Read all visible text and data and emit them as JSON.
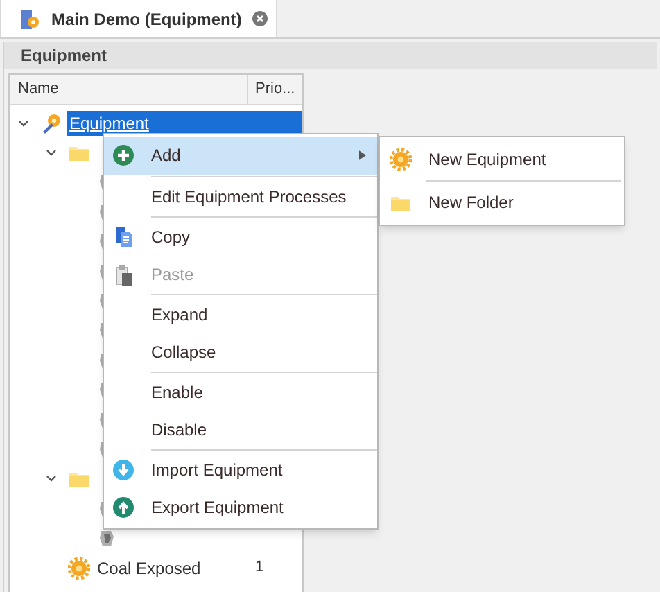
{
  "document_tab": {
    "title": "Main Demo (Equipment)",
    "selected": true
  },
  "panel": {
    "title": "Equipment"
  },
  "tree": {
    "columns": [
      "Name",
      "Prio..."
    ],
    "rows": [
      {
        "kind": "root",
        "label": "Equipment",
        "selected": true,
        "expanded": true,
        "children": [
          {
            "kind": "folder",
            "expanded": true,
            "children": [
              {
                "kind": "item"
              },
              {
                "kind": "item"
              },
              {
                "kind": "item"
              },
              {
                "kind": "item"
              },
              {
                "kind": "item"
              },
              {
                "kind": "item"
              },
              {
                "kind": "item"
              },
              {
                "kind": "item"
              },
              {
                "kind": "item"
              },
              {
                "kind": "item"
              }
            ]
          },
          {
            "kind": "folder",
            "expanded": true,
            "children": [
              {
                "kind": "item"
              },
              {
                "kind": "item"
              }
            ]
          },
          {
            "kind": "gear",
            "label": "Coal Exposed",
            "priority": "1"
          }
        ]
      }
    ]
  },
  "context_menu": {
    "items": [
      {
        "kind": "add",
        "label": "Add",
        "selected": true,
        "submenu": true,
        "disabled": false
      },
      {
        "kind": "separator"
      },
      {
        "kind": "plain",
        "label": "Edit Equipment Processes",
        "disabled": false
      },
      {
        "kind": "separator"
      },
      {
        "kind": "copy",
        "label": "Copy",
        "disabled": false
      },
      {
        "kind": "paste",
        "label": "Paste",
        "disabled": true
      },
      {
        "kind": "separator"
      },
      {
        "kind": "plain",
        "label": "Expand",
        "disabled": false
      },
      {
        "kind": "plain",
        "label": "Collapse",
        "disabled": false
      },
      {
        "kind": "separator"
      },
      {
        "kind": "plain",
        "label": "Enable",
        "disabled": false
      },
      {
        "kind": "plain",
        "label": "Disable",
        "disabled": false
      },
      {
        "kind": "separator"
      },
      {
        "kind": "import",
        "label": "Import Equipment",
        "disabled": false
      },
      {
        "kind": "export",
        "label": "Export Equipment",
        "disabled": false
      }
    ]
  },
  "submenu": {
    "items": [
      {
        "kind": "gear",
        "label": "New Equipment"
      },
      {
        "kind": "separator"
      },
      {
        "kind": "folder",
        "label": "New Folder"
      }
    ]
  }
}
